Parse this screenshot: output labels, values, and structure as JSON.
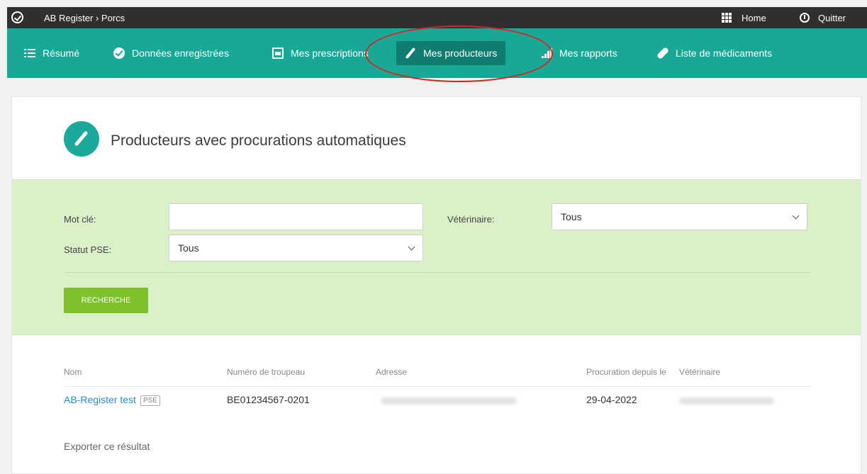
{
  "topbar": {
    "breadcrumb": "AB Register › Porcs",
    "home_label": "Home",
    "quit_label": "Quitter",
    "icons": [
      "check-circle-icon",
      "grid-icon",
      "power-icon"
    ]
  },
  "nav": {
    "items": [
      {
        "label": "Résumé",
        "icon": "list-icon"
      },
      {
        "label": "Données enregistrées",
        "icon": "check-circle-icon"
      },
      {
        "label": "Mes prescriptions",
        "icon": "document-icon"
      },
      {
        "label": "Mes producteurs",
        "icon": "syringe-icon",
        "active": true
      },
      {
        "label": "Mes rapports",
        "icon": "bar-chart-icon"
      },
      {
        "label": "Liste de médicaments",
        "icon": "pill-icon"
      }
    ],
    "bg_color": "#17a896",
    "active_color": "#0f7e70"
  },
  "page": {
    "title": "Producteurs avec procurations automatiques"
  },
  "filters": {
    "keyword_label": "Mot clé:",
    "keyword_value": "",
    "vet_label": "Vétérinaire:",
    "vet_value": "Tous",
    "pse_label": "Statut PSE:",
    "pse_value": "Tous",
    "search_button": "RECHERCHE",
    "bg_color": "#daf0c8",
    "button_color": "#7ec12c"
  },
  "table": {
    "headers": [
      "Nom",
      "Numéro de troupeau",
      "Adresse",
      "Procuration depuis le",
      "Vétérinaire"
    ],
    "rows": [
      {
        "nom": "AB-Register test",
        "badge": "PSE",
        "troupeau": "BE01234567-0201",
        "date": "29-04-2022"
      }
    ],
    "link_color": "#2a8ccc"
  },
  "export_link": "Exporter ce résultat"
}
